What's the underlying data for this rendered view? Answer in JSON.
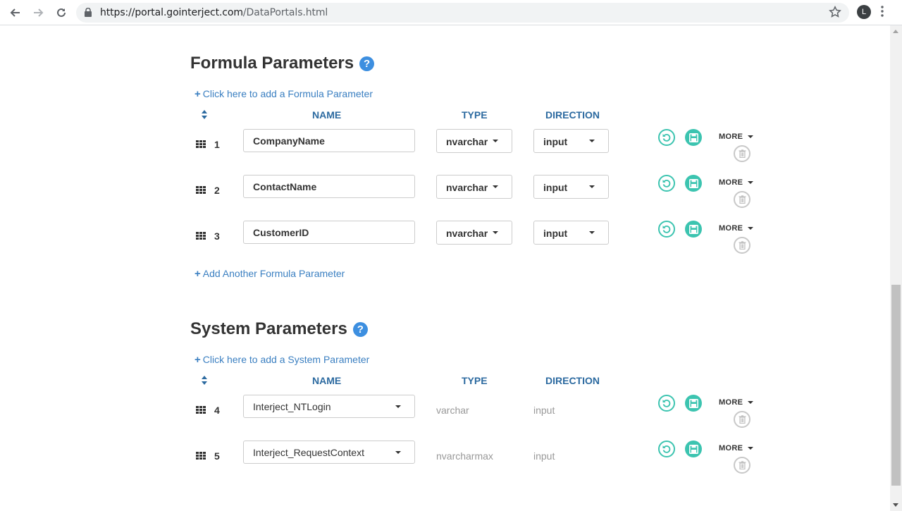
{
  "browser": {
    "url_host": "https://portal.gointerject.com",
    "url_path": "/DataPortals.html",
    "profile_initial": "L"
  },
  "formula": {
    "title": "Formula Parameters",
    "help": "?",
    "add_top": "Click here to add a Formula Parameter",
    "add_bottom": "Add Another Formula Parameter",
    "headers": {
      "name": "NAME",
      "type": "TYPE",
      "direction": "DIRECTION"
    },
    "rows": [
      {
        "num": "1",
        "name": "CompanyName",
        "type": "nvarchar",
        "direction": "input",
        "more": "MORE"
      },
      {
        "num": "2",
        "name": "ContactName",
        "type": "nvarchar",
        "direction": "input",
        "more": "MORE"
      },
      {
        "num": "3",
        "name": "CustomerID",
        "type": "nvarchar",
        "direction": "input",
        "more": "MORE"
      }
    ]
  },
  "system": {
    "title": "System Parameters",
    "help": "?",
    "add_top": "Click here to add a System Parameter",
    "headers": {
      "name": "NAME",
      "type": "TYPE",
      "direction": "DIRECTION"
    },
    "rows": [
      {
        "num": "4",
        "name": "Interject_NTLogin",
        "type": "varchar",
        "direction": "input",
        "more": "MORE"
      },
      {
        "num": "5",
        "name": "Interject_RequestContext",
        "type": "nvarcharmax",
        "direction": "input",
        "more": "MORE"
      }
    ]
  },
  "colors": {
    "accent_teal": "#3cc4b0",
    "link_blue": "#3a7fc1",
    "header_blue": "#2c6aa0",
    "help_blue": "#3d8fe0"
  }
}
